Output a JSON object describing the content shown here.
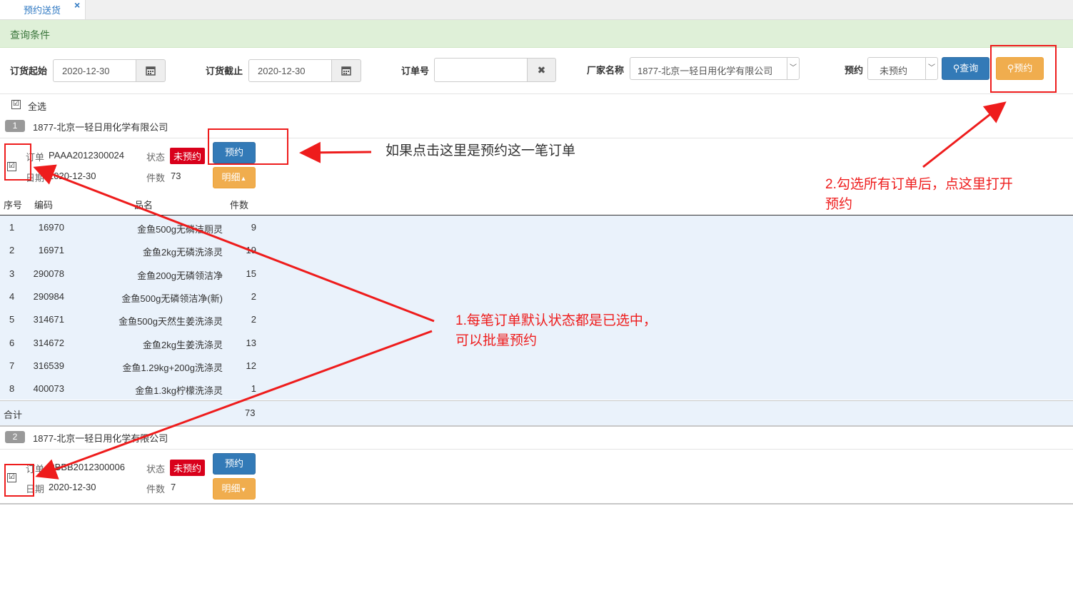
{
  "tab": {
    "label": "预约送货"
  },
  "query": {
    "title": "查询条件"
  },
  "filters": {
    "start_label": "订货起始",
    "start_value": "2020-12-30",
    "end_label": "订货截止",
    "end_value": "2020-12-30",
    "order_label": "订单号",
    "order_value": "",
    "vendor_label": "厂家名称",
    "vendor_value": "1877-北京一轻日用化学有限公司",
    "reserve_label": "预约",
    "reserve_value": "未预约",
    "search_button": "查询",
    "reserve_button": "预约"
  },
  "select_all": {
    "checked": "☑",
    "label": "全选"
  },
  "orders": [
    {
      "index": "1",
      "vendor": "1877-北京一轻日用化学有限公司",
      "order_label": "订单",
      "order_no": "PAAA2012300024",
      "status_label": "状态",
      "status": "未预约",
      "date_label": "日期",
      "date": "2020-12-30",
      "qty_label": "件数",
      "qty": "73",
      "reserve_btn": "预约",
      "detail_btn": "明细",
      "checked": "☑"
    },
    {
      "index": "2",
      "vendor": "1877-北京一轻日用化学有限公司",
      "order_label": "订单",
      "order_no": "PBBB2012300006",
      "status_label": "状态",
      "status": "未预约",
      "date_label": "日期",
      "date": "2020-12-30",
      "qty_label": "件数",
      "qty": "7",
      "reserve_btn": "预约",
      "detail_btn": "明细",
      "checked": "☑"
    }
  ],
  "detail_table": {
    "headers": [
      "序号",
      "编码",
      "品名",
      "件数"
    ],
    "rows": [
      [
        "1",
        "16970",
        "金鱼500g无磷洁厕灵",
        "9"
      ],
      [
        "2",
        "16971",
        "金鱼2kg无磷洗涤灵",
        "19"
      ],
      [
        "3",
        "290078",
        "金鱼200g无磷领洁净",
        "15"
      ],
      [
        "4",
        "290984",
        "金鱼500g无磷领洁净(新)",
        "2"
      ],
      [
        "5",
        "314671",
        "金鱼500g天然生姜洗涤灵",
        "2"
      ],
      [
        "6",
        "314672",
        "金鱼2kg生姜洗涤灵",
        "13"
      ],
      [
        "7",
        "316539",
        "金鱼1.29kg+200g洗涤灵",
        "12"
      ],
      [
        "8",
        "400073",
        "金鱼1.3kg柠檬洗涤灵",
        "1"
      ]
    ],
    "footer_label": "合计",
    "footer_total": "73"
  },
  "annotations": {
    "single": "如果点击这里是预约这一笔订单",
    "batch_line1": "1.每笔订单默认状态都是已选中，",
    "batch_line2": "可以批量预约",
    "open_line1": "2.勾选所有订单后，点这里打开",
    "open_line2": "预约"
  },
  "colors": {
    "accent": "#337ab7",
    "warning": "#f0ad4e",
    "danger": "#d9001b",
    "annotation": "#ee1c1c"
  },
  "icons": {
    "calendar": "calendar-icon",
    "clear": "close-icon",
    "search": "search-icon",
    "caret": "caret-up-icon"
  }
}
